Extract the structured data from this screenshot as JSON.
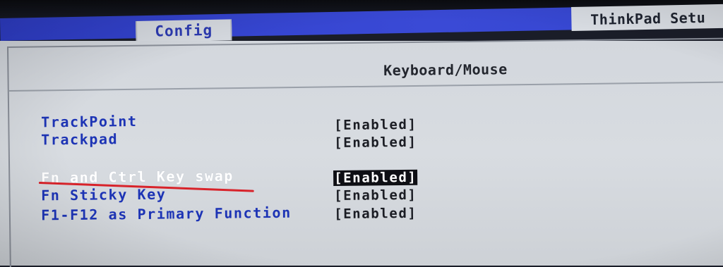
{
  "header": {
    "app_title": "ThinkPad Setu",
    "active_tab": "Config"
  },
  "section": {
    "title": "Keyboard/Mouse"
  },
  "settings": [
    {
      "label": "TrackPoint",
      "value": "[Enabled]"
    },
    {
      "label": "Trackpad",
      "value": "[Enabled]"
    },
    {
      "label": "Fn and Ctrl Key swap",
      "value": "[Enabled]",
      "selected": true
    },
    {
      "label": "Fn Sticky Key",
      "value": "[Enabled]"
    },
    {
      "label": "F1-F12 as Primary Function",
      "value": "[Enabled]"
    }
  ],
  "colors": {
    "menubar": "#3445cf",
    "label": "#1d34b5",
    "selected_label": "#ffffff",
    "highlight_bg": "#0e0f14",
    "annotation_underline": "#d8232a"
  }
}
